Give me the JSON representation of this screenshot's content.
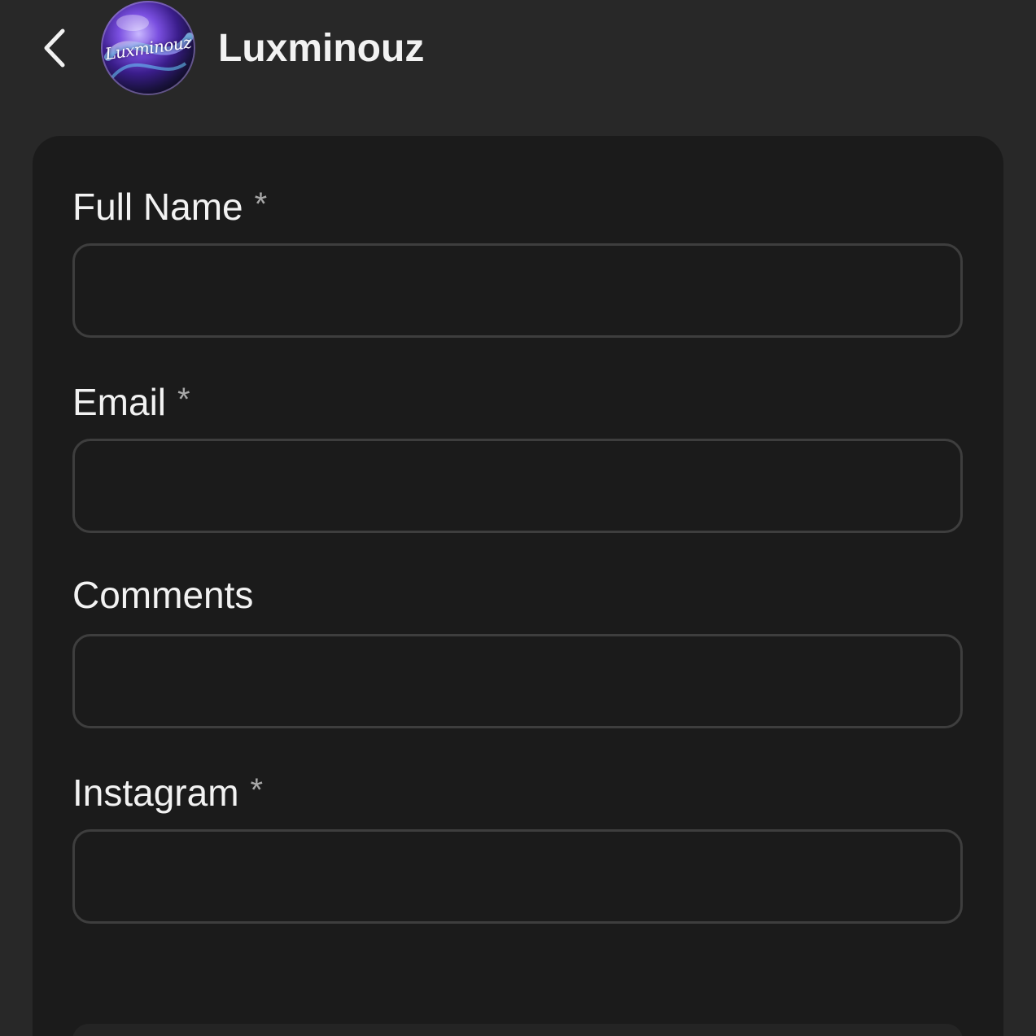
{
  "header": {
    "back_icon": "chevron-left-icon",
    "avatar_text": "Luxminouz",
    "title": "Luxminouz"
  },
  "form": {
    "fields": [
      {
        "label": "Full Name",
        "required_mark": "*",
        "value": "",
        "placeholder": ""
      },
      {
        "label": "Email",
        "required_mark": "*",
        "value": "",
        "placeholder": ""
      },
      {
        "label": "Comments",
        "required_mark": "",
        "value": "",
        "placeholder": ""
      },
      {
        "label": "Instagram",
        "required_mark": "*",
        "value": "",
        "placeholder": ""
      }
    ]
  },
  "colors": {
    "background": "#282828",
    "card": "#1b1b1b",
    "input_border": "#3e3e3e",
    "text": "#f2f2f2",
    "required_mark": "#a8a8a8"
  }
}
